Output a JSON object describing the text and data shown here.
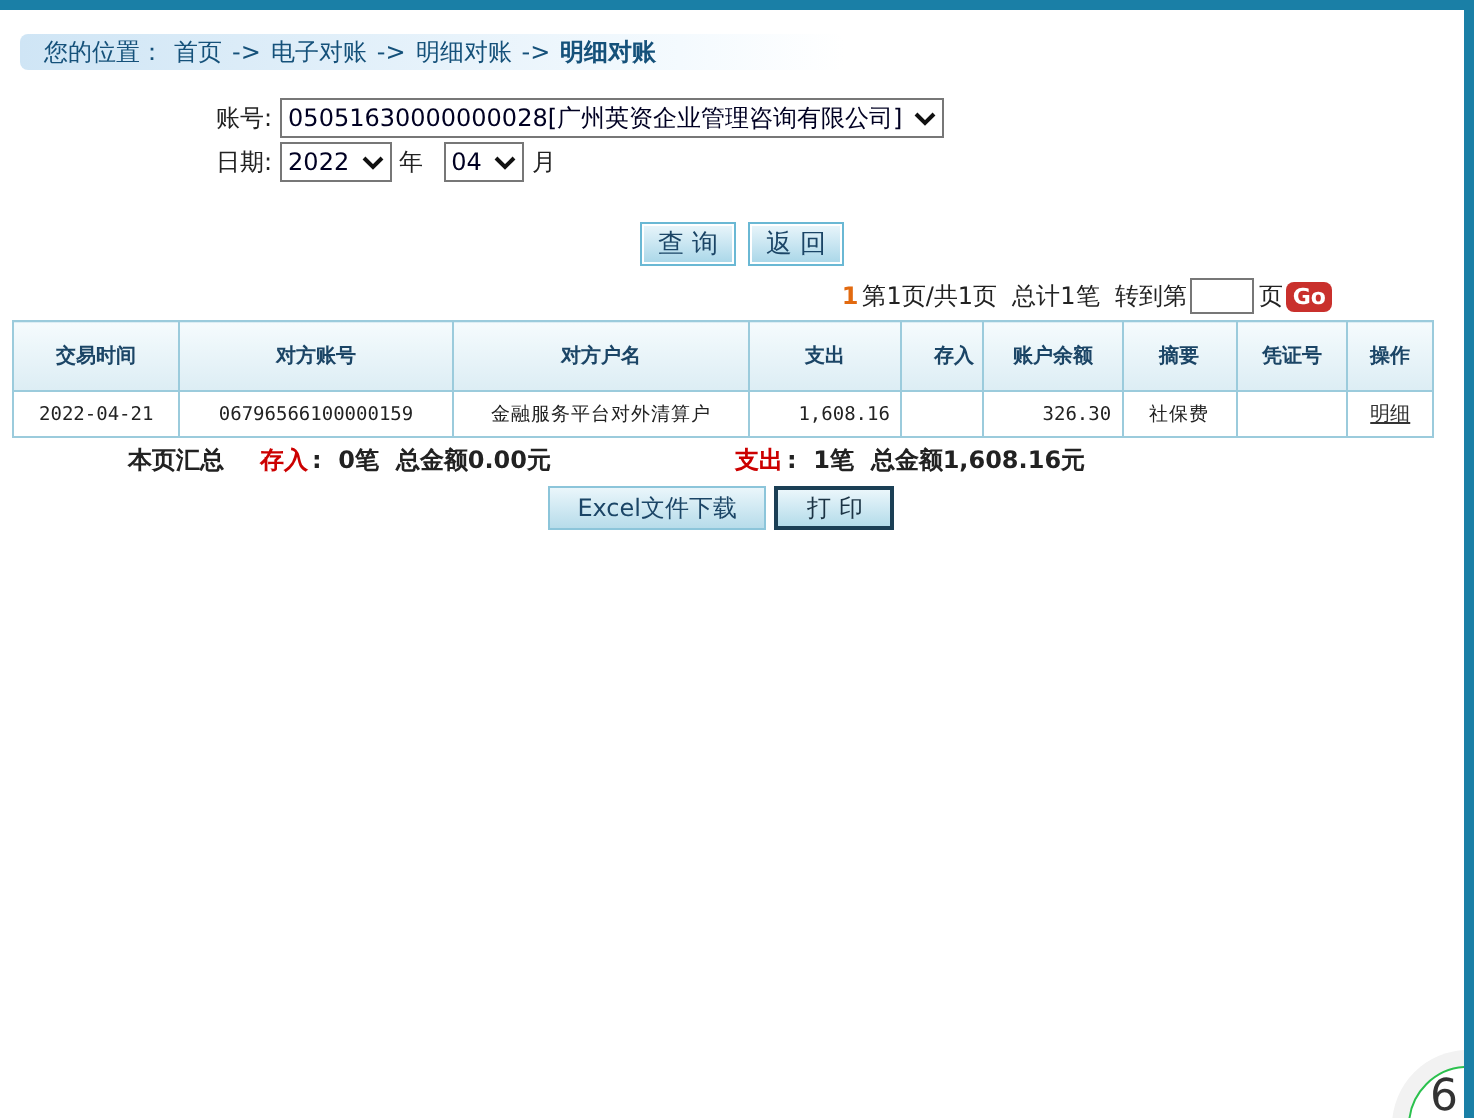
{
  "breadcrumb": {
    "label": "您的位置：",
    "items": [
      {
        "text": "首页",
        "current": false
      },
      {
        "text": "电子对账",
        "current": false
      },
      {
        "text": "明细对账",
        "current": false
      },
      {
        "text": "明细对账",
        "current": true
      }
    ],
    "separator": "->"
  },
  "form": {
    "account_label": "账号:",
    "account_value": "05051630000000028[广州英资企业管理咨询有限公司]",
    "date_label": "日期:",
    "year_value": "2022",
    "year_unit": "年",
    "month_value": "04",
    "month_unit": "月"
  },
  "buttons": [
    "查 询",
    "返 回"
  ],
  "pager": {
    "current": "1",
    "info": "第1页/共1页  总计1笔  转到第",
    "page_unit": "页",
    "go": "Go"
  },
  "table": {
    "columns": [
      "交易时间",
      "对方账号",
      "对方户名",
      "支出",
      "存入",
      "账户余额",
      "摘要",
      "凭证号",
      "操作"
    ],
    "rows": [
      {
        "cells": [
          "2022-04-21",
          "06796566100000159",
          "金融服务平台对外清算户",
          "1,608.16",
          "",
          "326.30",
          "社保费",
          ""
        ],
        "action": "明细"
      }
    ]
  },
  "summary": {
    "title": "本页汇总",
    "in_label": "存入",
    "in_text": ":  0笔  总金额0.00元",
    "out_label": "支出",
    "out_text": ":  1笔  总金额1,608.16元"
  },
  "bottom_buttons": [
    {
      "text": "Excel文件下载",
      "kind": "light"
    },
    {
      "text": "打 印",
      "kind": "dark"
    }
  ],
  "corner_badge": "6"
}
